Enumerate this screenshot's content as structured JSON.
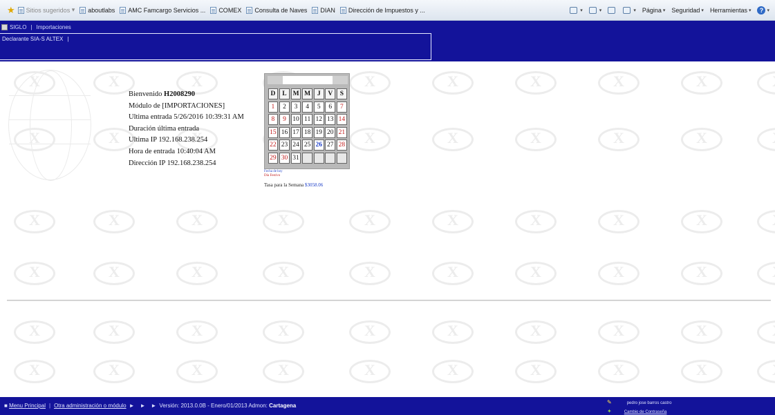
{
  "favorites_bar": {
    "items": [
      "Sitios sugeridos",
      "aboutlabs",
      "AMC Famcargo Servicios ...",
      "COMEX",
      "Consulta de Naves",
      "DIAN",
      "Dirección de Impuestos y ..."
    ],
    "commands": [
      "Página",
      "Seguridad",
      "Herramientas"
    ]
  },
  "header": {
    "app": "SIGLO",
    "breadcrumb_section": "Importaciones",
    "declarante": "Declarante SIA-S ALTEX"
  },
  "info": {
    "welcome_label": "Bienvenido",
    "user_code": "H2008290",
    "module": "Módulo de [IMPORTACIONES]",
    "last_entry": "Ultima entrada 5/26/2016 10:39:31 AM",
    "last_duration": "Duración última entrada",
    "last_ip": "Ultima IP 192.168.238.254",
    "entry_time": "Hora de entrada 10:40:04 AM",
    "ip_address": "Dirección IP 192.168.238.254"
  },
  "calendar": {
    "weekdays": [
      "D",
      "L",
      "M",
      "M",
      "J",
      "V",
      "S"
    ],
    "weeks": [
      [
        "1",
        "2",
        "3",
        "4",
        "5",
        "6",
        "7"
      ],
      [
        "8",
        "9",
        "10",
        "11",
        "12",
        "13",
        "14"
      ],
      [
        "15",
        "16",
        "17",
        "18",
        "19",
        "20",
        "21"
      ],
      [
        "22",
        "23",
        "24",
        "25",
        "26",
        "27",
        "28"
      ],
      [
        "29",
        "30",
        "31",
        "",
        "",
        "",
        ""
      ]
    ],
    "today": "26",
    "holidays": [
      "1",
      "9",
      "30"
    ],
    "footer_line1": "Fecha de hoy",
    "footer_line2": "Día Festivo",
    "tasa_label": "Tasa para la Semana",
    "tasa_value": "$3058.06",
    "colors": {
      "weekend": "#c01818",
      "today": "#1d3fc9"
    }
  },
  "footer": {
    "menu_principal": "Menu Principal",
    "otra_admin": "Otra administración o módulo",
    "version": "Versión: 2013.0.0B - Enero/01/2013 Admon:",
    "admon": "Cartagena",
    "user_name": "pedro jose barros castro",
    "change_password": "Cambio de Contraseña"
  },
  "colors": {
    "header_bg": "#13139a",
    "accent_blue": "#1d3fc9"
  }
}
